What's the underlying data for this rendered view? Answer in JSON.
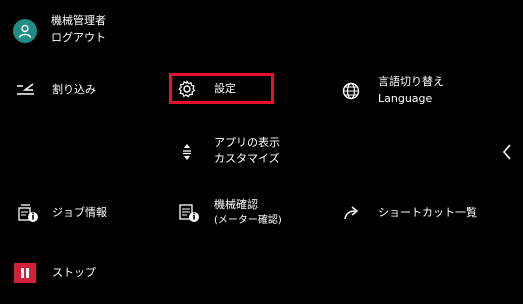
{
  "user": {
    "name": "機械管理者",
    "logout_label": "ログアウト"
  },
  "menu": {
    "interrupt": "割り込み",
    "settings": "設定",
    "language": {
      "label": "言語切り替え",
      "sub": "Language"
    },
    "app_display": {
      "line1": "アプリの表示",
      "line2": "カスタマイズ"
    },
    "job_info": "ジョブ情報",
    "machine_check": {
      "line1": "機械確認",
      "line2": "(メーター確認)"
    },
    "shortcut_list": "ショートカット一覧",
    "stop": "ストップ"
  },
  "colors": {
    "background": "#000000",
    "avatar": "#1f8d86",
    "highlight": "#e8102a",
    "stop": "#d3213a",
    "text": "#ffffff"
  },
  "icons": {
    "avatar": "user-icon",
    "interrupt": "interrupt-icon",
    "settings": "gear-icon",
    "language": "globe-icon",
    "app_display": "sort-icon",
    "job_info": "job-info-icon",
    "machine_check": "machine-info-icon",
    "shortcut": "share-arrow-icon",
    "stop": "stop-icon",
    "collapse": "chevron-left-icon"
  }
}
